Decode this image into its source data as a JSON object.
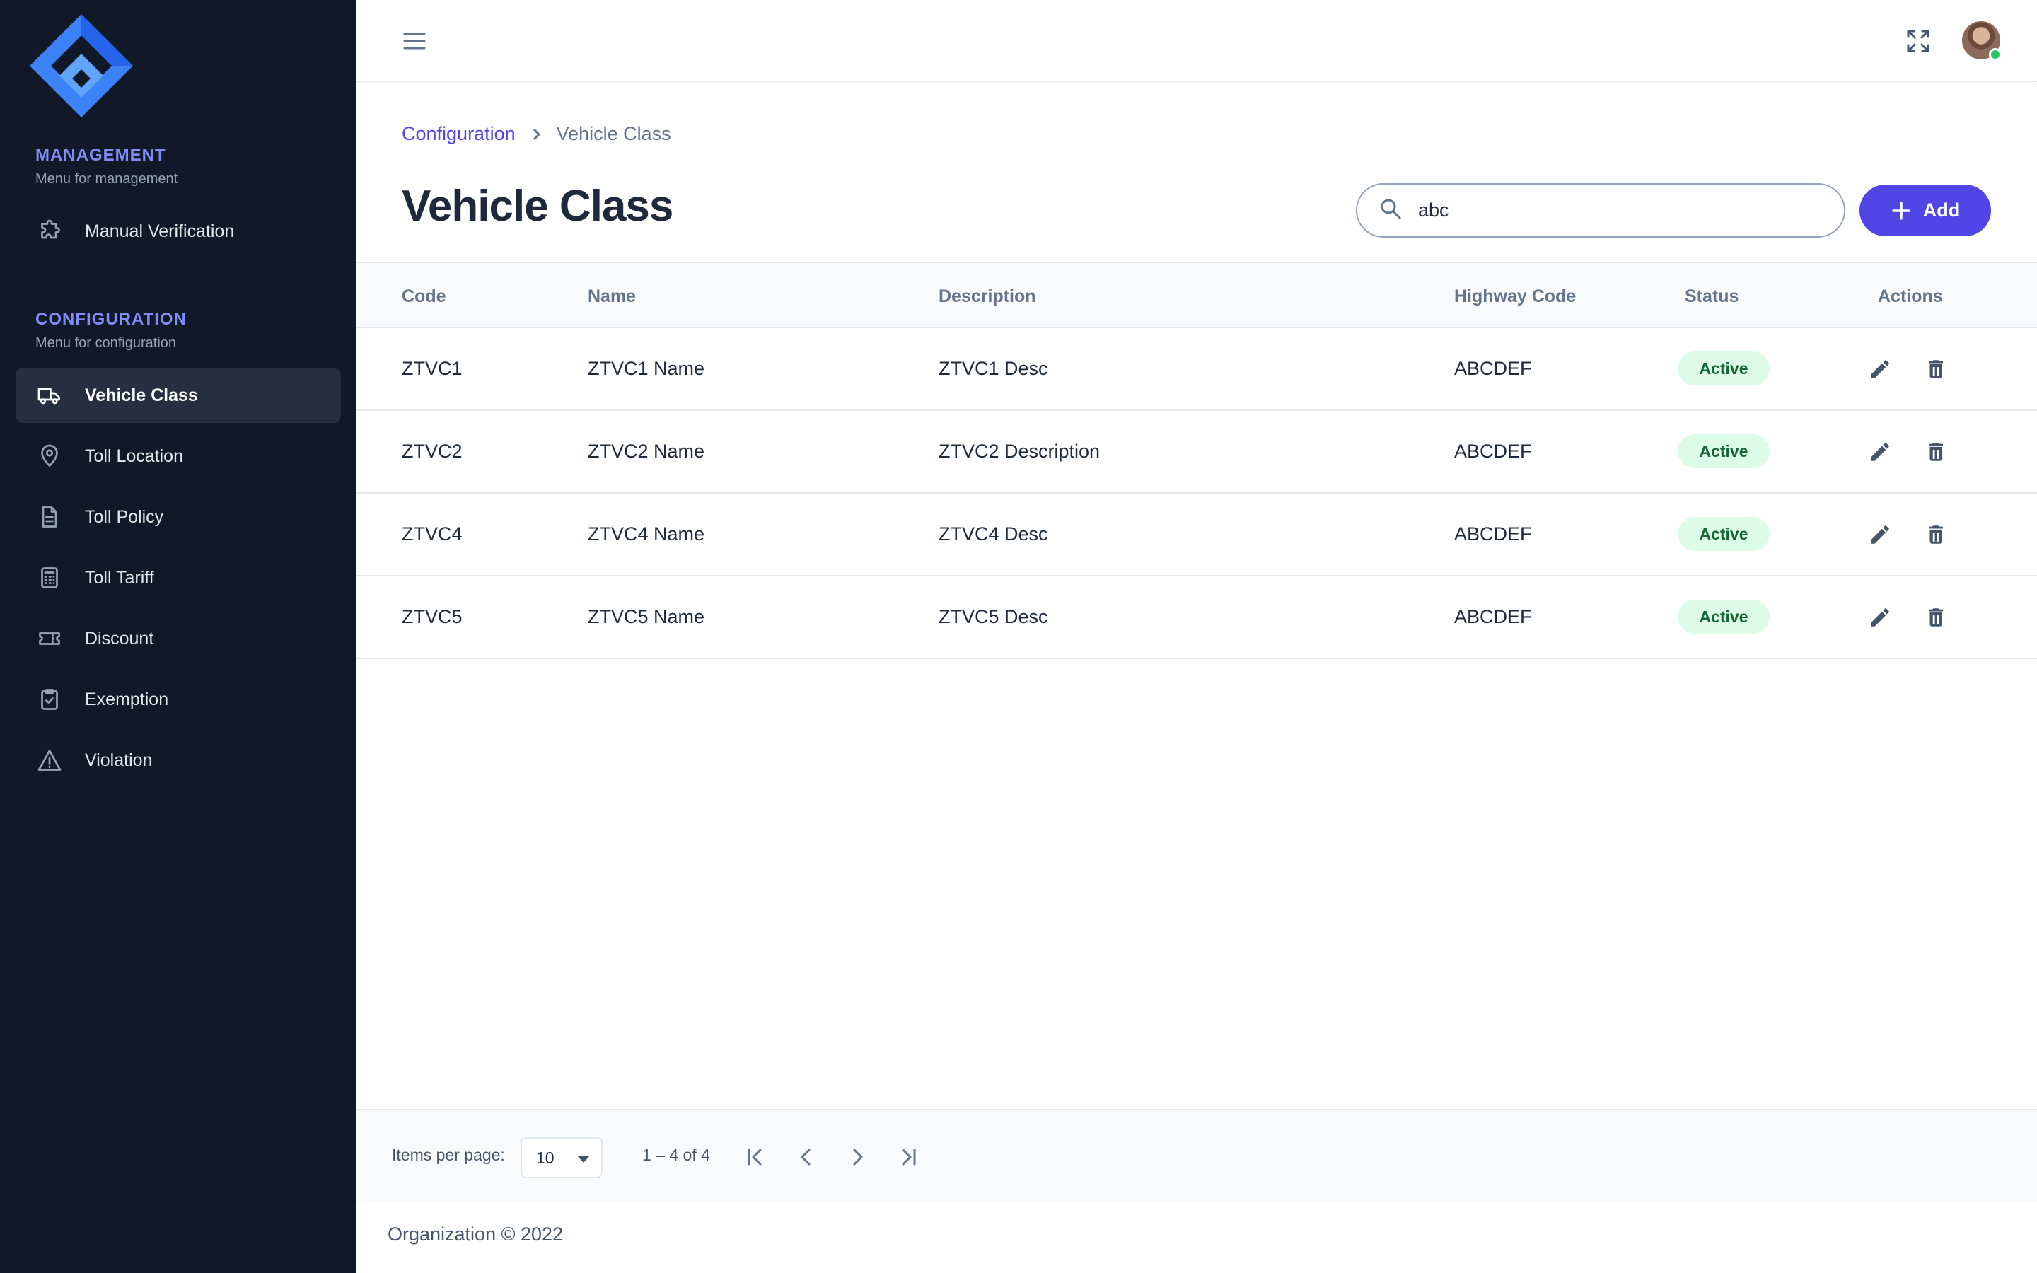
{
  "sidebar": {
    "management": {
      "title": "MANAGEMENT",
      "subtitle": "Menu for management",
      "items": [
        {
          "label": "Manual Verification",
          "icon": "puzzle-icon"
        }
      ]
    },
    "configuration": {
      "title": "CONFIGURATION",
      "subtitle": "Menu for configuration",
      "items": [
        {
          "label": "Vehicle Class",
          "icon": "truck-icon",
          "active": true
        },
        {
          "label": "Toll Location",
          "icon": "location-pin-icon"
        },
        {
          "label": "Toll Policy",
          "icon": "document-icon"
        },
        {
          "label": "Toll Tariff",
          "icon": "calculator-icon"
        },
        {
          "label": "Discount",
          "icon": "ticket-icon"
        },
        {
          "label": "Exemption",
          "icon": "clipboard-check-icon"
        },
        {
          "label": "Violation",
          "icon": "warning-icon"
        }
      ]
    }
  },
  "breadcrumb": {
    "parent": "Configuration",
    "current": "Vehicle Class"
  },
  "page": {
    "title": "Vehicle Class"
  },
  "search": {
    "value": "abc"
  },
  "toolbar": {
    "add_label": "Add"
  },
  "table": {
    "columns": [
      "Code",
      "Name",
      "Description",
      "Highway Code",
      "Status",
      "Actions"
    ],
    "rows": [
      {
        "code": "ZTVC1",
        "name": "ZTVC1 Name",
        "description": "ZTVC1 Desc",
        "highway_code": "ABCDEF",
        "status": "Active"
      },
      {
        "code": "ZTVC2",
        "name": "ZTVC2 Name",
        "description": "ZTVC2 Description",
        "highway_code": "ABCDEF",
        "status": "Active"
      },
      {
        "code": "ZTVC4",
        "name": "ZTVC4 Name",
        "description": "ZTVC4 Desc",
        "highway_code": "ABCDEF",
        "status": "Active"
      },
      {
        "code": "ZTVC5",
        "name": "ZTVC5 Name",
        "description": "ZTVC5 Desc",
        "highway_code": "ABCDEF",
        "status": "Active"
      }
    ]
  },
  "pagination": {
    "items_per_page_label": "Items per page:",
    "items_per_page": "10",
    "range": "1 – 4 of 4"
  },
  "footer": {
    "text": "Organization © 2022"
  },
  "colors": {
    "sidebar_bg": "#111827",
    "accent": "#4f46e5",
    "section_title": "#818cf8",
    "status_active_bg": "#dcfce7",
    "status_active_text": "#166534"
  }
}
